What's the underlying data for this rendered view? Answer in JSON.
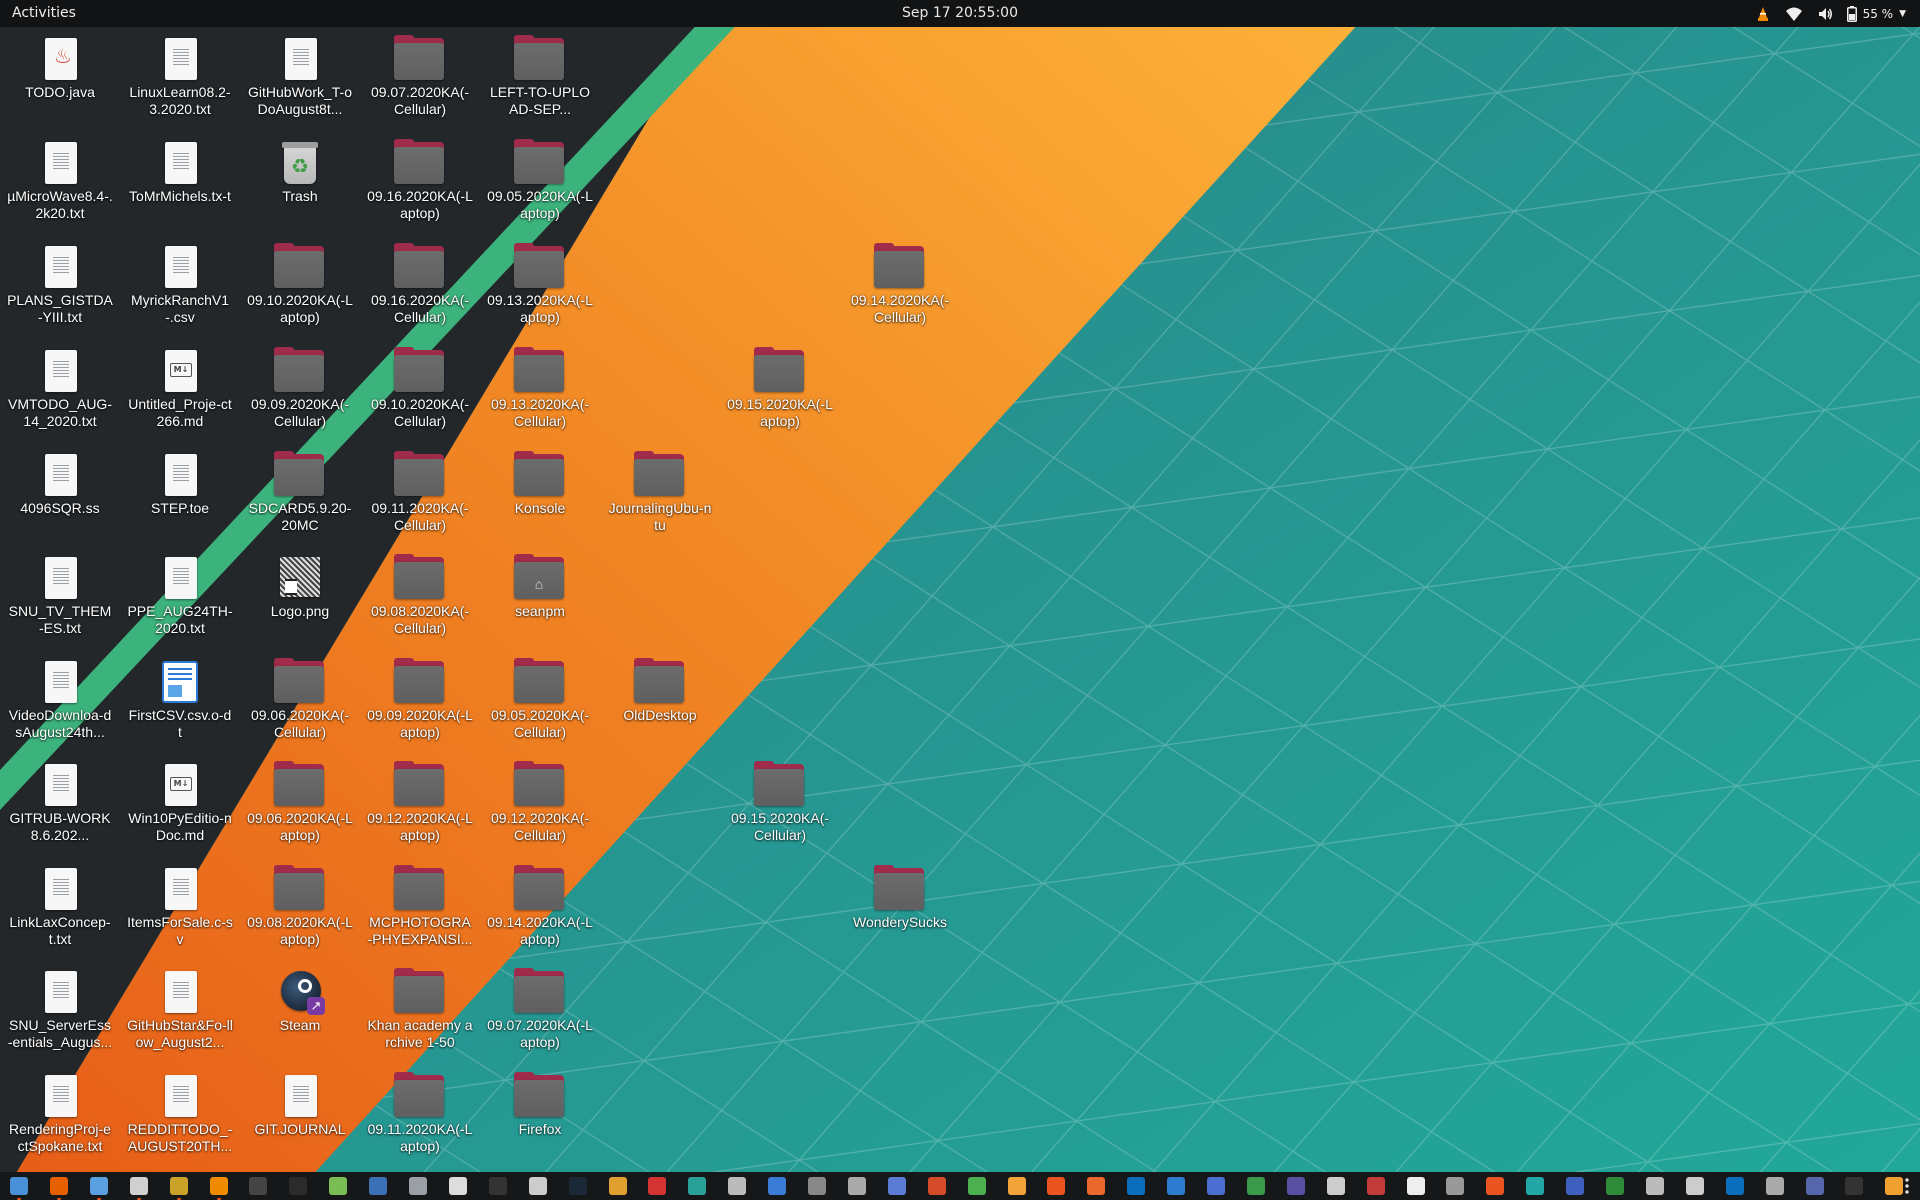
{
  "topbar": {
    "activities": "Activities",
    "clock": "Sep 17  20:55:00",
    "battery_pct": "55 %",
    "tray_icons": [
      "vlc-icon",
      "wifi-icon",
      "volume-icon",
      "battery-icon",
      "system-menu-caret-icon"
    ]
  },
  "colors": {
    "topbar_bg": "#111314",
    "wallpaper_dark": "#23272a",
    "wallpaper_green": "#3cb37c",
    "wallpaper_orange": "#e96a1f",
    "wallpaper_orange_light": "#fba535",
    "wallpaper_teal": "#2a8e93",
    "folder_tab": "#a12b4b",
    "folder_body": "#656565",
    "accent": "#e95420"
  },
  "desktop": {
    "icons": [
      {
        "id": "todo-java",
        "kind": "java",
        "label": "TODO.java"
      },
      {
        "id": "linuxlearn",
        "kind": "file",
        "label": "LinuxLearn08.2-3.2020.txt"
      },
      {
        "id": "githubwork",
        "kind": "file",
        "label": "GitHubWork_T-oDoAugust8t..."
      },
      {
        "id": "f-0907-cell",
        "kind": "folder",
        "label": "09.07.2020KA(-Cellular)"
      },
      {
        "id": "left-to-upload",
        "kind": "folder",
        "label": "LEFT-TO-UPLOAD-SEP..."
      },
      {
        "id": "microwave",
        "kind": "file",
        "label": "µMicroWave8.4-.2k20.txt"
      },
      {
        "id": "tomrmichels",
        "kind": "file",
        "label": "ToMrMichels.tx-t"
      },
      {
        "id": "trash",
        "kind": "trash",
        "label": "Trash"
      },
      {
        "id": "f-0916-lap",
        "kind": "folder",
        "label": "09.16.2020KA(-Laptop)"
      },
      {
        "id": "f-0905-lap",
        "kind": "folder",
        "label": "09.05.2020KA(-Laptop)"
      },
      {
        "id": "plans-gistda",
        "kind": "file",
        "label": "PLANS_GISTDA-YIII.txt"
      },
      {
        "id": "myrickranch",
        "kind": "file",
        "label": "MyrickRanchV1-.csv"
      },
      {
        "id": "f-0910-lap",
        "kind": "folder",
        "label": "09.10.2020KA(-Laptop)"
      },
      {
        "id": "f-0916-cell",
        "kind": "folder",
        "label": "09.16.2020KA(-Cellular)"
      },
      {
        "id": "f-0913-lap",
        "kind": "folder",
        "label": "09.13.2020KA(-Laptop)"
      },
      {
        "id": "f-0914-cell",
        "kind": "folder",
        "label": "09.14.2020KA(-Cellular)"
      },
      {
        "id": "vmtodo",
        "kind": "file",
        "label": "VMTODO_AUG-14_2020.txt"
      },
      {
        "id": "untitled-proj",
        "kind": "md",
        "label": "Untitled_Proje-ct266.md"
      },
      {
        "id": "f-0909-cell",
        "kind": "folder",
        "label": "09.09.2020KA(-Cellular)"
      },
      {
        "id": "f-0910-cell",
        "kind": "folder",
        "label": "09.10.2020KA(-Cellular)"
      },
      {
        "id": "f-0913-cell",
        "kind": "folder",
        "label": "09.13.2020KA(-Cellular)"
      },
      {
        "id": "f-0915-lap",
        "kind": "folder",
        "label": "09.15.2020KA(-Laptop)"
      },
      {
        "id": "sqr4096",
        "kind": "file",
        "label": "4096SQR.ss"
      },
      {
        "id": "step-toe",
        "kind": "file",
        "label": "STEP.toe"
      },
      {
        "id": "sdcard",
        "kind": "folder",
        "label": "SDCARD5.9.20-20MC"
      },
      {
        "id": "f-0911-cell",
        "kind": "folder",
        "label": "09.11.2020KA(-Cellular)"
      },
      {
        "id": "konsole",
        "kind": "folder",
        "label": "Konsole"
      },
      {
        "id": "journaling",
        "kind": "folder",
        "label": "JournalingUbu-ntu"
      },
      {
        "id": "snu-tv",
        "kind": "file",
        "label": "SNU_TV_THEM-ES.txt"
      },
      {
        "id": "ppe-aug24",
        "kind": "file",
        "label": "PPE_AUG24TH-2020.txt"
      },
      {
        "id": "logo-png",
        "kind": "png",
        "label": "Logo.png"
      },
      {
        "id": "f-0908-cell",
        "kind": "folder",
        "label": "09.08.2020KA(-Cellular)"
      },
      {
        "id": "seanpm",
        "kind": "homefolder",
        "label": "seanpm"
      },
      {
        "id": "videodownloads",
        "kind": "file",
        "label": "VideoDownloa-dsAugust24th..."
      },
      {
        "id": "firstcsv",
        "kind": "odt",
        "label": "FirstCSV.csv.o-dt"
      },
      {
        "id": "f-0906-cell",
        "kind": "folder",
        "label": "09.06.2020KA(-Cellular)"
      },
      {
        "id": "f-0909-lap",
        "kind": "folder",
        "label": "09.09.2020KA(-Laptop)"
      },
      {
        "id": "f-0905-cell",
        "kind": "folder",
        "label": "09.05.2020KA(-Cellular)"
      },
      {
        "id": "olddesktop",
        "kind": "folder",
        "label": "OldDesktop"
      },
      {
        "id": "gitrub",
        "kind": "file",
        "label": "GITRUB-WORK8.6.202..."
      },
      {
        "id": "win10py",
        "kind": "md",
        "label": "Win10PyEditio-nDoc.md"
      },
      {
        "id": "f-0906-lap",
        "kind": "folder",
        "label": "09.06.2020KA(-Laptop)"
      },
      {
        "id": "f-0912-lap",
        "kind": "folder",
        "label": "09.12.2020KA(-Laptop)"
      },
      {
        "id": "f-0912-cell",
        "kind": "folder",
        "label": "09.12.2020KA(-Cellular)"
      },
      {
        "id": "f-0915-cell",
        "kind": "folder",
        "label": "09.15.2020KA(-Cellular)"
      },
      {
        "id": "linklax",
        "kind": "file",
        "label": "LinkLaxConcep-t.txt"
      },
      {
        "id": "itemsforsale",
        "kind": "file",
        "label": "ItemsForSale.c-sv"
      },
      {
        "id": "f-0908-lap",
        "kind": "folder",
        "label": "09.08.2020KA(-Laptop)"
      },
      {
        "id": "mcphotography",
        "kind": "folder",
        "label": "MCPHOTOGRA-PHYEXPANSI..."
      },
      {
        "id": "f-0914-lap",
        "kind": "folder",
        "label": "09.14.2020KA(-Laptop)"
      },
      {
        "id": "wonderysucks",
        "kind": "folder",
        "label": "WonderySucks"
      },
      {
        "id": "snu-server",
        "kind": "file",
        "label": "SNU_ServerEss-entials_Augus..."
      },
      {
        "id": "githubstar",
        "kind": "file",
        "label": "GitHubStar&Fo-llow_August2..."
      },
      {
        "id": "steam",
        "kind": "steam",
        "label": "Steam"
      },
      {
        "id": "khan",
        "kind": "folder",
        "label": "Khan academy archive 1-50"
      },
      {
        "id": "f-0907-lap",
        "kind": "folder",
        "label": "09.07.2020KA(-Laptop)"
      },
      {
        "id": "renderingproj",
        "kind": "file",
        "label": "RenderingProj-ectSpokane.txt"
      },
      {
        "id": "reddittodo",
        "kind": "file",
        "label": "REDDITTODO_-AUGUST20TH..."
      },
      {
        "id": "git-journal",
        "kind": "file",
        "label": "GIT.JOURNAL"
      },
      {
        "id": "f-0911-lap",
        "kind": "folder",
        "label": "09.11.2020KA(-Laptop)"
      },
      {
        "id": "firefox-folder",
        "kind": "folder",
        "label": "Firefox"
      }
    ]
  },
  "dock": {
    "items": [
      {
        "icon": "text-editor-icon",
        "color": "#4a90d9",
        "running": true
      },
      {
        "icon": "firefox-icon",
        "color": "#e66000",
        "running": true
      },
      {
        "icon": "notes-icon",
        "color": "#5aa0e0",
        "running": true
      },
      {
        "icon": "files-icon",
        "color": "#d0d0d0",
        "running": true
      },
      {
        "icon": "archive-icon",
        "color": "#c9a227",
        "running": true
      },
      {
        "icon": "vlc-icon",
        "color": "#f08a00",
        "running": true
      },
      {
        "icon": "monitor-icon",
        "color": "#444444",
        "running": false
      },
      {
        "icon": "terminal-icon",
        "color": "#2b2b2b",
        "running": false
      },
      {
        "icon": "image-viewer-icon",
        "color": "#7bbd55",
        "running": false
      },
      {
        "icon": "screenshot-icon",
        "color": "#3b6fb6",
        "running": false
      },
      {
        "icon": "search-icon",
        "color": "#9aa0a6",
        "running": false
      },
      {
        "icon": "reader-icon",
        "color": "#dddddd",
        "running": false
      },
      {
        "icon": "console-icon",
        "color": "#333333",
        "running": false
      },
      {
        "icon": "blender-icon",
        "color": "#cccccc",
        "running": false
      },
      {
        "icon": "steam-icon",
        "color": "#1b2838",
        "running": false
      },
      {
        "icon": "game-icon",
        "color": "#e0a030",
        "running": false
      },
      {
        "icon": "cards-icon",
        "color": "#d33333",
        "running": false
      },
      {
        "icon": "chip-icon",
        "color": "#2aa198",
        "running": false
      },
      {
        "icon": "calc-icon",
        "color": "#bbbbbb",
        "running": false
      },
      {
        "icon": "doc-icon",
        "color": "#3a7bd5",
        "running": false
      },
      {
        "icon": "target-icon",
        "color": "#888888",
        "running": false
      },
      {
        "icon": "tools-icon",
        "color": "#aaaaaa",
        "running": false
      },
      {
        "icon": "camera-icon",
        "color": "#5b7bd5",
        "running": false
      },
      {
        "icon": "globe-icon",
        "color": "#d54c2a",
        "running": false
      },
      {
        "icon": "sheet-icon",
        "color": "#4caf50",
        "running": false
      },
      {
        "icon": "paint-icon",
        "color": "#f2a33a",
        "running": false
      },
      {
        "icon": "store-icon",
        "color": "#e95420",
        "running": false
      },
      {
        "icon": "slides-icon",
        "color": "#e8672d",
        "running": false
      },
      {
        "icon": "dell-icon",
        "color": "#0a6ebd",
        "running": false
      },
      {
        "icon": "window-icon",
        "color": "#2e7bcf",
        "running": false
      },
      {
        "icon": "drive-icon",
        "color": "#4a6fd0",
        "running": false
      },
      {
        "icon": "map-icon",
        "color": "#3b9a4a",
        "running": false
      },
      {
        "icon": "wave-icon",
        "color": "#5a4fa3",
        "running": false
      },
      {
        "icon": "pen-icon",
        "color": "#cccccc",
        "running": false
      },
      {
        "icon": "scope-icon",
        "color": "#c23b3b",
        "running": false
      },
      {
        "icon": "page-icon",
        "color": "#eeeeee",
        "running": false
      },
      {
        "icon": "settings-icon",
        "color": "#999999",
        "running": false
      },
      {
        "icon": "ubuntu-icon",
        "color": "#e95420",
        "running": false
      },
      {
        "icon": "chat-icon",
        "color": "#23a6a6",
        "running": false
      },
      {
        "icon": "music-icon",
        "color": "#4060c0",
        "running": false
      },
      {
        "icon": "disk-icon",
        "color": "#2f8a3a",
        "running": false
      },
      {
        "icon": "clock-icon",
        "color": "#bbbbbb",
        "running": false
      },
      {
        "icon": "keyboard-icon",
        "color": "#cccccc",
        "running": false
      },
      {
        "icon": "dell-support-icon",
        "color": "#0a6ebd",
        "running": false
      },
      {
        "icon": "gear-icon",
        "color": "#aaaaaa",
        "running": false
      },
      {
        "icon": "screen-icon",
        "color": "#5566aa",
        "running": false
      },
      {
        "icon": "tux-icon",
        "color": "#333333",
        "running": false
      },
      {
        "icon": "weather-icon",
        "color": "#f0a030",
        "running": false
      }
    ],
    "show_apps_icon": "grid-icon"
  }
}
